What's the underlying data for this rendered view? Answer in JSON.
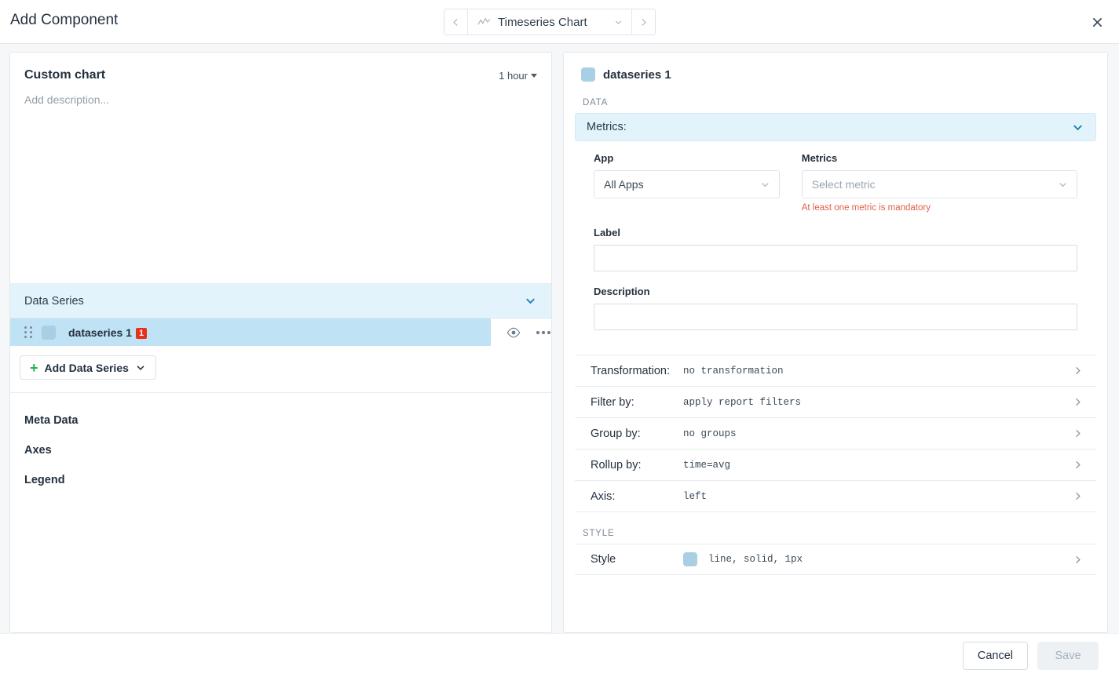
{
  "topbar": {
    "title": "Add Component",
    "prev_icon": "chevron-left-icon",
    "next_icon": "chevron-right-icon",
    "chart_type": "Timeseries Chart",
    "chart_type_icon": "timeseries-chart-icon",
    "close_icon": "close-icon"
  },
  "preview": {
    "title": "Custom chart",
    "period": "1 hour",
    "description_placeholder": "Add description..."
  },
  "data_series_section": {
    "header": "Data Series",
    "items": [
      {
        "name": "dataseries 1",
        "error_count": "1",
        "color": "#a8cfe3"
      }
    ],
    "add_button": "Add Data Series"
  },
  "left_nav": [
    {
      "label": "Meta Data"
    },
    {
      "label": "Axes"
    },
    {
      "label": "Legend"
    }
  ],
  "detail": {
    "series_title": "dataseries 1",
    "series_color": "#a8cfe3",
    "data_section_label": "DATA",
    "metrics_bar_label": "Metrics:",
    "app_label": "App",
    "app_value": "All Apps",
    "metrics_label": "Metrics",
    "metrics_placeholder": "Select metric",
    "metrics_error": "At least one metric is mandatory",
    "label_label": "Label",
    "label_value": "",
    "description_label": "Description",
    "description_value": "",
    "properties": [
      {
        "key": "Transformation:",
        "value": "no transformation"
      },
      {
        "key": "Filter by:",
        "value": "apply report filters"
      },
      {
        "key": "Group by:",
        "value": "no groups"
      },
      {
        "key": "Rollup by:",
        "value": "time=avg"
      },
      {
        "key": "Axis:",
        "value": "left"
      }
    ],
    "style_section_label": "STYLE",
    "style_key": "Style",
    "style_value": "line, solid, 1px",
    "style_color": "#a8cfe3"
  },
  "footer": {
    "cancel": "Cancel",
    "save": "Save"
  },
  "colors": {
    "accent_blue": "#1b7fad",
    "band_blue": "#e3f3fb",
    "selected_row": "#bfe2f4",
    "error_red": "#e8311a",
    "error_text": "#e0604a",
    "add_green": "#22b24c",
    "series_swatch": "#a8cfe3"
  }
}
